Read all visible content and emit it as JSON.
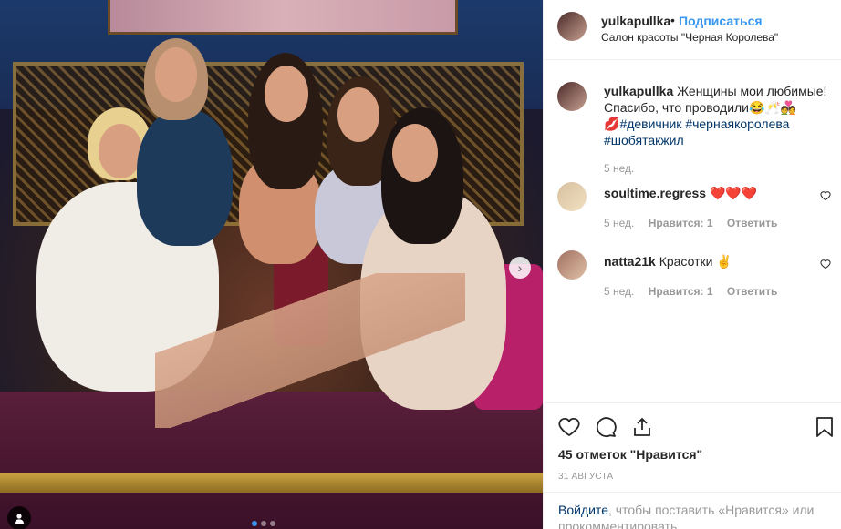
{
  "post": {
    "username": "yulkapullka",
    "separator": "•",
    "follow_label": "Подписаться",
    "location": "Салон красоты \"Черная Королева\""
  },
  "caption": {
    "username": "yulkapullka",
    "text": " Женщины мои любимые! Спасибо, что проводили😂🥂💑",
    "text2": "💋",
    "tags": [
      "#девичник",
      "#черная королева",
      "#шобятакжил"
    ],
    "time": "5 нед."
  },
  "comments": [
    {
      "username": "soultime.regress",
      "text": " ❤️❤️❤️",
      "time": "5 нед.",
      "likes": "Нравится: 1",
      "reply": "Ответить"
    },
    {
      "username": "natta21k",
      "text": " Красотки ✌️",
      "time": "5 нед.",
      "likes": "Нравится: 1",
      "reply": "Ответить"
    }
  ],
  "actions": {
    "likes_text": "45 отметок \"Нравится\"",
    "date": "31 АВГУСТА"
  },
  "login": {
    "link": "Войдите",
    "text": ", чтобы поставить «Нравится» или прокомментировать."
  },
  "photo": {
    "next_icon": "chevron-right-icon",
    "dots": 3,
    "active_dot": 0
  },
  "colors": {
    "accent": "#3897f0",
    "text": "#262626",
    "muted": "#999999",
    "hashtag": "#003569"
  }
}
